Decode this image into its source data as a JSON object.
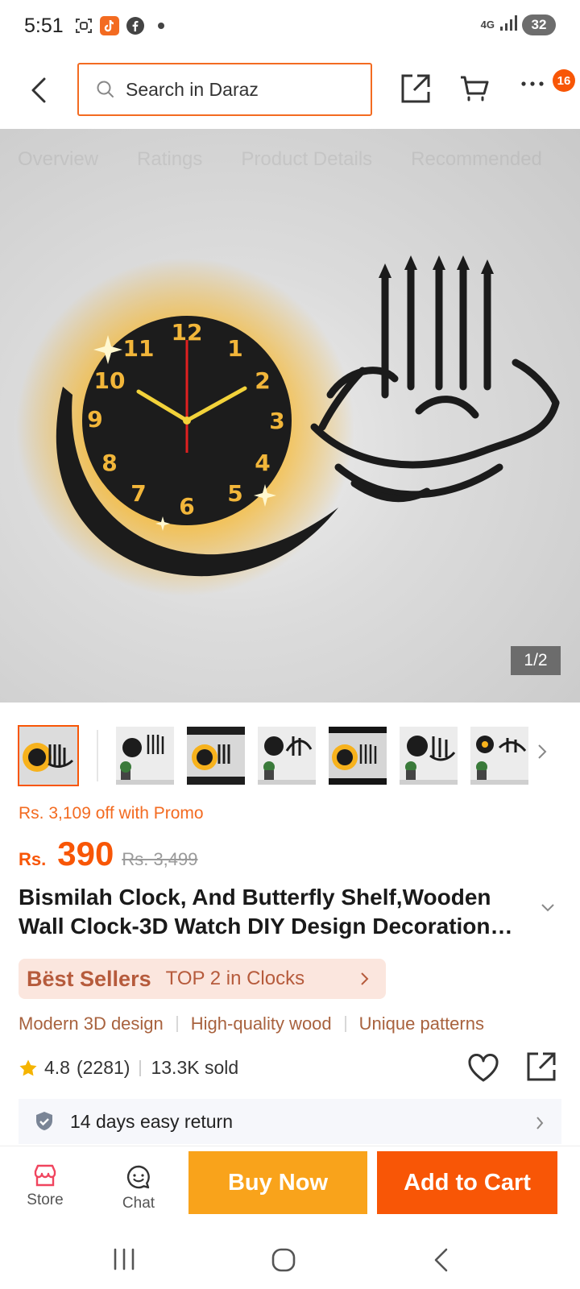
{
  "status_bar": {
    "time": "5:51",
    "network": "4G",
    "battery": "32",
    "icons": [
      "screenshot-icon",
      "tiktok-icon",
      "facebook-icon",
      "dot-icon",
      "signal-icon",
      "battery-icon"
    ]
  },
  "top_nav": {
    "search_placeholder": "Search in Daraz",
    "cart_badge": "16",
    "icons": [
      "back-icon",
      "search-icon",
      "share-icon",
      "cart-icon",
      "more-icon"
    ]
  },
  "hero": {
    "page_indicator": "1/2",
    "ghost_tabs": [
      "Overview",
      "Ratings",
      "Product Details",
      "Recommended"
    ],
    "clock_numbers": [
      "12",
      "1",
      "2",
      "3",
      "4",
      "5",
      "6",
      "7",
      "8",
      "9",
      "10",
      "11"
    ]
  },
  "product": {
    "promo_text": "Rs. 3,109 off with Promo",
    "currency": "Rs.",
    "price": "390",
    "original_price": "Rs. 3,499",
    "title": "Bismilah Clock, And Butterfly Shelf,Wooden Wall Clock-3D Watch DIY Design Decoration…",
    "best_seller_label": "Bëst Sellers",
    "best_seller_rank": "TOP 2 in Clocks",
    "features": [
      "Modern 3D design",
      "High-quality wood",
      "Unique patterns"
    ],
    "rating": "4.8",
    "reviews": "(2281)",
    "sold": "13.3K sold",
    "return_policy": "14 days easy return"
  },
  "bottom_bar": {
    "store_label": "Store",
    "chat_label": "Chat",
    "buy_now_label": "Buy Now",
    "add_to_cart_label": "Add to Cart"
  },
  "colors": {
    "brand_orange": "#f85606",
    "buy_now_yellow": "#f9a31b",
    "promo_orange": "#f36b21",
    "best_seller_bg": "#fbe6de",
    "feature_brown": "#a8623e",
    "star_yellow": "#f5b400"
  }
}
